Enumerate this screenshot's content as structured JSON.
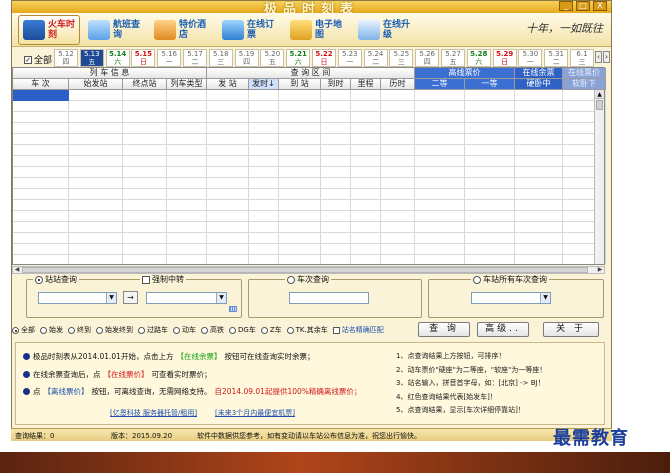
{
  "window": {
    "title": "极品时刻表",
    "buttons": [
      "_",
      "□",
      "X"
    ]
  },
  "toolbar": {
    "items": [
      {
        "label": "火车时刻",
        "icon": "train-icon",
        "active": true
      },
      {
        "label": "航班查询",
        "icon": "plane-icon"
      },
      {
        "label": "特价酒店",
        "icon": "hotel-icon"
      },
      {
        "label": "在线订票",
        "icon": "ticket-icon"
      },
      {
        "label": "电子地图",
        "icon": "map-icon"
      },
      {
        "label": "在线升级",
        "icon": "upgrade-icon"
      }
    ],
    "signature": "十年，一如既往"
  },
  "dates": {
    "all_label": "全部",
    "items": [
      {
        "date": "5.12",
        "day": "四"
      },
      {
        "date": "5.13",
        "day": "五",
        "state": "selected"
      },
      {
        "date": "5.14",
        "day": "六",
        "state": "green"
      },
      {
        "date": "5.15",
        "day": "日",
        "state": "red"
      },
      {
        "date": "5.16",
        "day": "一"
      },
      {
        "date": "5.17",
        "day": "二"
      },
      {
        "date": "5.18",
        "day": "三"
      },
      {
        "date": "5.19",
        "day": "四"
      },
      {
        "date": "5.20",
        "day": "五"
      },
      {
        "date": "5.21",
        "day": "六",
        "state": "green"
      },
      {
        "date": "5.22",
        "day": "日",
        "state": "red"
      },
      {
        "date": "5.23",
        "day": "一"
      },
      {
        "date": "5.24",
        "day": "二"
      },
      {
        "date": "5.25",
        "day": "三"
      },
      {
        "date": "5.26",
        "day": "四"
      },
      {
        "date": "5.27",
        "day": "五"
      },
      {
        "date": "5.28",
        "day": "六",
        "state": "green"
      },
      {
        "date": "5.29",
        "day": "日",
        "state": "red"
      },
      {
        "date": "5.30",
        "day": "一"
      },
      {
        "date": "5.31",
        "day": "二"
      },
      {
        "date": "6.1",
        "day": "三"
      }
    ]
  },
  "table": {
    "group_headers": [
      {
        "label": "列 车 信 息",
        "style": ""
      },
      {
        "label": "查 询 区 间",
        "style": ""
      },
      {
        "label": "高线票价",
        "style": "blue"
      },
      {
        "label": "在线余票",
        "style": "bluedark"
      },
      {
        "label": "在线票价",
        "style": "dim"
      }
    ],
    "columns": [
      {
        "label": "车 次",
        "style": ""
      },
      {
        "label": "始发站",
        "style": ""
      },
      {
        "label": "终点站",
        "style": ""
      },
      {
        "label": "列车类型",
        "style": ""
      },
      {
        "label": "发 站",
        "style": ""
      },
      {
        "label": "发时↓",
        "style": "sort"
      },
      {
        "label": "到 站",
        "style": ""
      },
      {
        "label": "到时",
        "style": ""
      },
      {
        "label": "里程",
        "style": ""
      },
      {
        "label": "历时",
        "style": ""
      },
      {
        "label": "二等",
        "style": "blue"
      },
      {
        "label": "一等",
        "style": "blue"
      },
      {
        "label": "硬卧中",
        "style": "bluedark"
      },
      {
        "label": "软卧下",
        "style": "dim"
      }
    ]
  },
  "query": {
    "station": {
      "label": "站站查询",
      "transfer_label": "强制中转",
      "swap": "→"
    },
    "train": {
      "label": "车次查询"
    },
    "all_trains": {
      "label": "车站所有车次查询"
    }
  },
  "filters": [
    {
      "label": "全部",
      "type": "radio",
      "on": true
    },
    {
      "label": "始发",
      "type": "radio"
    },
    {
      "label": "终到",
      "type": "radio"
    },
    {
      "label": "始发终到",
      "type": "radio"
    },
    {
      "label": "过路车",
      "type": "radio"
    },
    {
      "label": "动车",
      "type": "radio"
    },
    {
      "label": "高铁",
      "type": "radio"
    },
    {
      "label": "DG车",
      "type": "radio"
    },
    {
      "label": "Z车",
      "type": "radio"
    },
    {
      "label": "TK.其余车",
      "type": "radio"
    },
    {
      "label": "站名精确匹配",
      "type": "check"
    }
  ],
  "buttons": {
    "query": "查 询",
    "advanced": "高级..",
    "about": "关 于"
  },
  "info": {
    "line1": {
      "a": "极品时刻表从2014.01.01开始，点击上方",
      "b": "【在线余票】",
      "c": "按钮可在线查询实时余票；"
    },
    "line2": {
      "a": "在线余票查询后，点",
      "b": "【在线票价】",
      "c": "可查看实时票价；"
    },
    "line3": {
      "a": "点",
      "b": "【离线票价】",
      "c": "按钮，可离线查询，无需网络支持。",
      "d": "自2014.09.01起提供100%精确离线票价；"
    },
    "link1": "[亿恩科技 服务器托管/租用]",
    "link2": "[未来3个月内最便宜机票]",
    "tips": [
      "1、点查询结果上方按钮，可排序！",
      "2、动车票价\"硬座\"为二等座，\"软座\"为一等座！",
      "3、站名输入，拼音首字母，如：[北京] -> BJ！",
      "4、红色查询结果代表[始发车]！",
      "5、点查询结果，显示[车次详细停靠站]！"
    ]
  },
  "status": {
    "result": "查询结果：0",
    "version": "版本：2015.09.20",
    "notice": "软件中数据供您参考，如有变动请以车站公布信息为准，祝您出行愉快。"
  },
  "watermark": "最需教育"
}
